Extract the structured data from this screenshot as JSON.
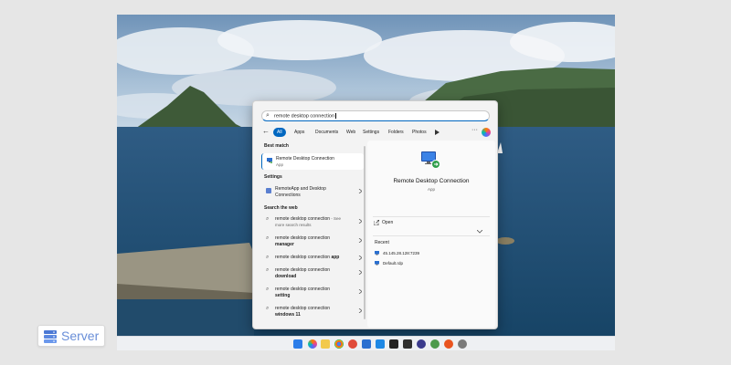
{
  "search": {
    "value": "remote desktop connection"
  },
  "filters": {
    "back_icon": "back-arrow-icon",
    "chips": [
      {
        "label": "All",
        "active": true
      },
      {
        "label": "Apps"
      },
      {
        "label": "Documents"
      },
      {
        "label": "Web"
      },
      {
        "label": "Settings"
      },
      {
        "label": "Folders"
      },
      {
        "label": "Photos"
      }
    ],
    "more_icon": "ellipsis-icon"
  },
  "left": {
    "best_match_title": "Best match",
    "best_match": {
      "name": "Remote Desktop Connection",
      "kind": "App"
    },
    "settings_title": "Settings",
    "settings_item": {
      "line1": "RemoteApp and Desktop",
      "line2": "Connections"
    },
    "web_title": "Search the web",
    "web_items": [
      {
        "text": "remote desktop connection",
        "suffix": " - See",
        "sub": "more search results"
      },
      {
        "text": "remote desktop connection",
        "bold": "manager"
      },
      {
        "text": "remote desktop connection ",
        "bold": "app"
      },
      {
        "text": "remote desktop connection",
        "bold": "download"
      },
      {
        "text": "remote desktop connection",
        "bold": "setting"
      },
      {
        "text": "remote desktop connection",
        "bold": "windows 11"
      }
    ]
  },
  "right": {
    "app_name": "Remote Desktop Connection",
    "app_kind": "App",
    "open_label": "Open",
    "recent_title": "Recent",
    "recent_items": [
      "45.145.28.128:7239",
      "Default.rdp"
    ]
  },
  "brand": {
    "name": "Server"
  },
  "colors": {
    "accent": "#0067c0",
    "brand": "#6a8fd8"
  }
}
